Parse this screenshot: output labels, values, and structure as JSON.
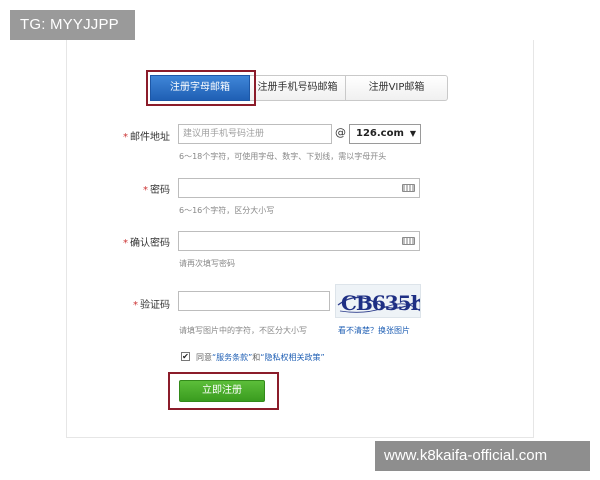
{
  "watermarks": {
    "top_left": "TG: MYYJJPP",
    "bottom_right": "www.k8kaifa-official.com"
  },
  "tabs": [
    {
      "label": "注册字母邮箱",
      "active": true
    },
    {
      "label": "注册手机号码邮箱",
      "active": false
    },
    {
      "label": "注册VIP邮箱",
      "active": false
    }
  ],
  "form": {
    "required_mark": "*",
    "email": {
      "label": "邮件地址",
      "placeholder": "建议用手机号码注册",
      "at": "@",
      "domain": "126.com",
      "hint": "6～18个字符，可使用字母、数字、下划线，需以字母开头"
    },
    "password": {
      "label": "密码",
      "hint": "6～16个字符，区分大小写"
    },
    "confirm_password": {
      "label": "确认密码",
      "hint": "请再次填写密码"
    },
    "captcha": {
      "label": "验证码",
      "hint": "请填写图片中的字符，不区分大小写",
      "image_text": "CB635h",
      "refresh_link": "看不清楚？换张图片"
    },
    "agreement": {
      "checked": true,
      "prefix": "同意",
      "terms": "“服务条款”",
      "conjunction": "和",
      "privacy": "“隐私权相关政策”"
    },
    "submit_label": "立即注册"
  },
  "colors": {
    "tab_active": "#1f5fb4",
    "highlight_border": "#8b1c2a",
    "submit_green": "#3a9c1f",
    "required_red": "#cc3333"
  }
}
